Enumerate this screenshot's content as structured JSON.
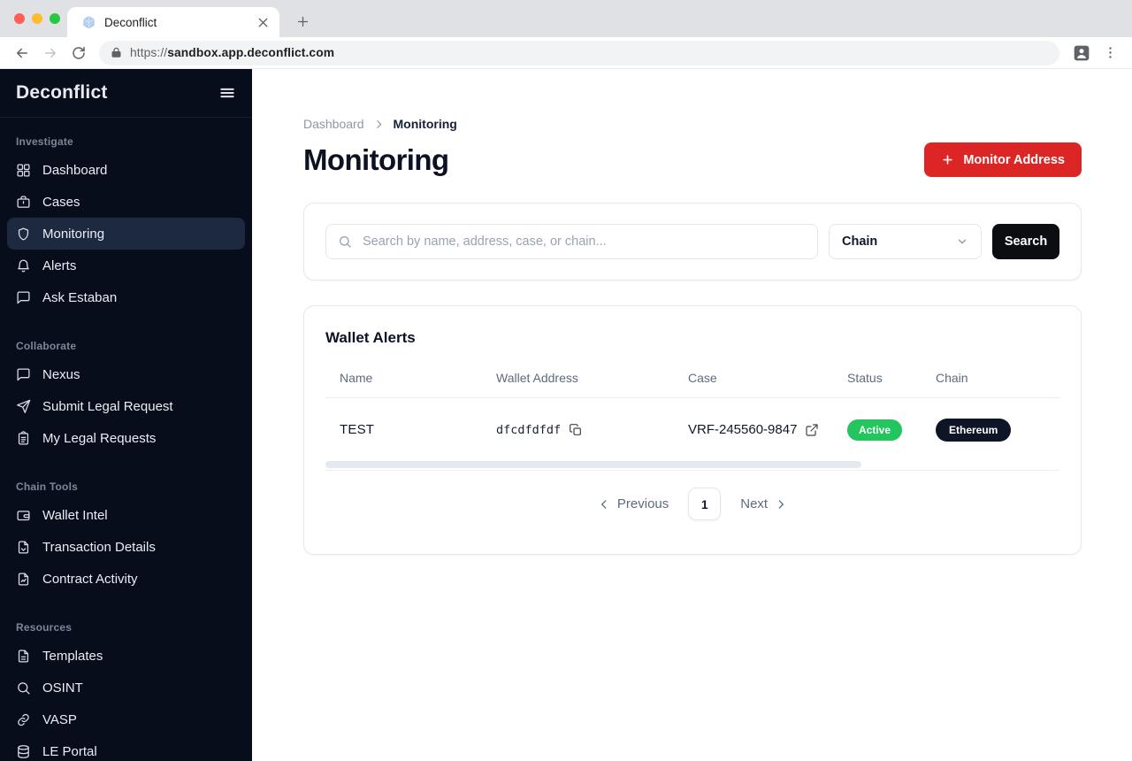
{
  "colors": {
    "accent_red": "#dc2626",
    "status_green": "#22c55e",
    "badge_dark": "#0d1526",
    "sidebar_bg": "#070d1b"
  },
  "browser": {
    "tab_title": "Deconflict",
    "url_scheme": "https://",
    "url_domain": "sandbox.app.deconflict.com"
  },
  "sidebar": {
    "logo": "Deconflict",
    "sections": [
      {
        "label": "Investigate",
        "items": [
          {
            "label": "Dashboard",
            "icon": "grid-icon",
            "active": false
          },
          {
            "label": "Cases",
            "icon": "briefcase-icon",
            "active": false
          },
          {
            "label": "Monitoring",
            "icon": "shield-icon",
            "active": true
          },
          {
            "label": "Alerts",
            "icon": "bell-icon",
            "active": false
          },
          {
            "label": "Ask Estaban",
            "icon": "chat-icon",
            "active": false
          }
        ]
      },
      {
        "label": "Collaborate",
        "items": [
          {
            "label": "Nexus",
            "icon": "chat-icon",
            "active": false
          },
          {
            "label": "Submit Legal Request",
            "icon": "send-icon",
            "active": false
          },
          {
            "label": "My Legal Requests",
            "icon": "clipboard-icon",
            "active": false
          }
        ]
      },
      {
        "label": "Chain Tools",
        "items": [
          {
            "label": "Wallet Intel",
            "icon": "wallet-icon",
            "active": false
          },
          {
            "label": "Transaction Details",
            "icon": "file-arrow-icon",
            "active": false
          },
          {
            "label": "Contract Activity",
            "icon": "file-chart-icon",
            "active": false
          }
        ]
      },
      {
        "label": "Resources",
        "items": [
          {
            "label": "Templates",
            "icon": "file-text-icon",
            "active": false
          },
          {
            "label": "OSINT",
            "icon": "search-icon",
            "active": false
          },
          {
            "label": "VASP",
            "icon": "link-icon",
            "active": false
          },
          {
            "label": "LE Portal",
            "icon": "database-icon",
            "active": false
          }
        ]
      }
    ]
  },
  "breadcrumb": {
    "parent": "Dashboard",
    "current": "Monitoring"
  },
  "page": {
    "title": "Monitoring",
    "monitor_button": "Monitor Address"
  },
  "search": {
    "placeholder": "Search by name, address, case, or chain...",
    "chain_filter": "Chain",
    "button": "Search"
  },
  "wallet_alerts": {
    "title": "Wallet Alerts",
    "columns": [
      "Name",
      "Wallet Address",
      "Case",
      "Status",
      "Chain"
    ],
    "rows": [
      {
        "name": "TEST",
        "address": "dfcdfdfdf",
        "case": "VRF-245560-9847",
        "status": "Active",
        "chain": "Ethereum"
      }
    ],
    "pagination": {
      "previous": "Previous",
      "page": "1",
      "next": "Next"
    }
  }
}
